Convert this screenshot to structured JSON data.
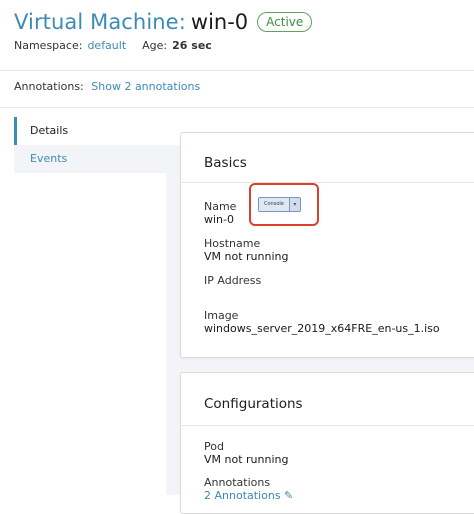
{
  "header": {
    "title_prefix": "Virtual Machine:",
    "vm_name": "win-0",
    "status": "Active",
    "namespace_label": "Namespace:",
    "namespace_value": "default",
    "age_label": "Age:",
    "age_value": "26 sec"
  },
  "annotations": {
    "label": "Annotations:",
    "link": "Show 2 annotations"
  },
  "tabs": [
    {
      "label": "Details",
      "selected": true
    },
    {
      "label": "Events",
      "selected": false
    }
  ],
  "basics": {
    "title": "Basics",
    "name_label": "Name",
    "name_value": "win-0",
    "console_button": "Console",
    "console_caret": "▾",
    "hostname_label": "Hostname",
    "hostname_value": "VM not running",
    "ip_label": "IP Address",
    "ip_value": "",
    "image_label": "Image",
    "image_value": "windows_server_2019_x64FRE_en-us_1.iso"
  },
  "configurations": {
    "title": "Configurations",
    "pod_label": "Pod",
    "pod_value": "VM not running",
    "annotations_label": "Annotations",
    "annotations_link": "2 Annotations ✎"
  },
  "colors": {
    "link": "#3d8ab6",
    "active_badge": "#3d8f3f",
    "highlight": "#d9412d"
  }
}
